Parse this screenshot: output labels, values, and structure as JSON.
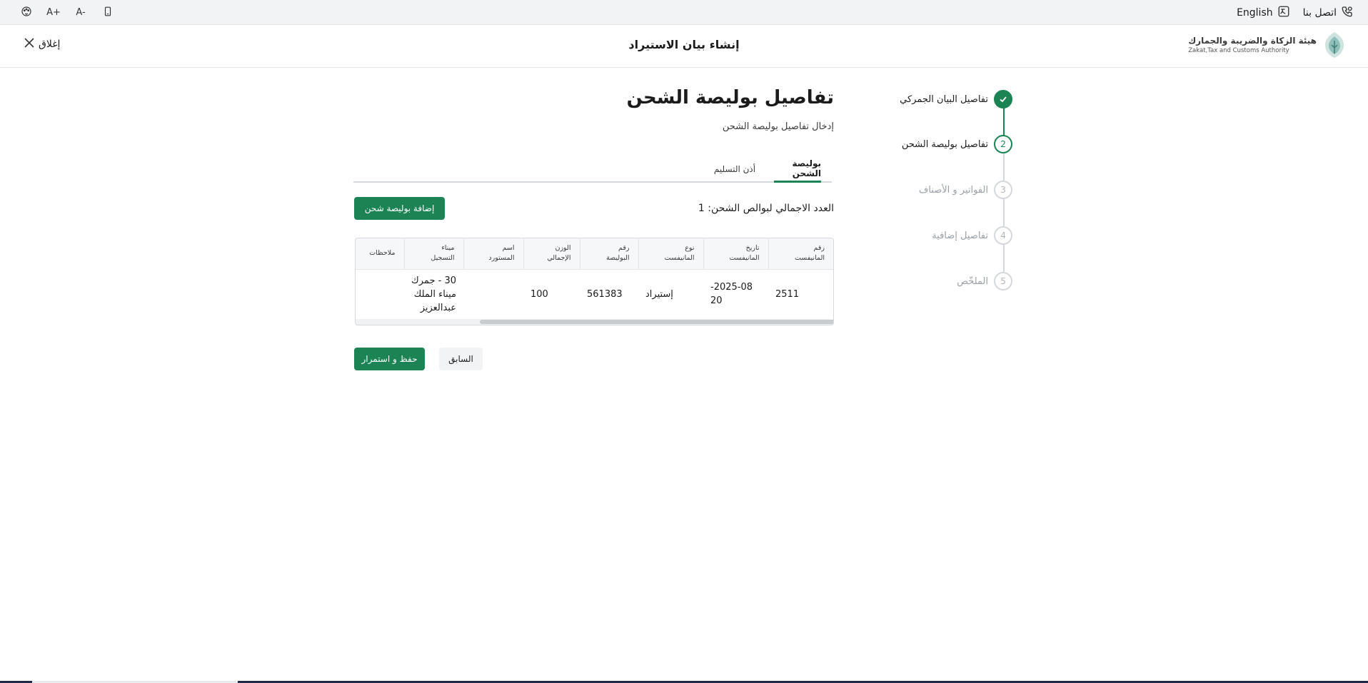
{
  "utility": {
    "contact_label": "اتصل بنا",
    "language_label": "English"
  },
  "header": {
    "logo_ar": "هيئة الزكاة والضريبة والجمارك",
    "logo_en": "Zakat,Tax and Customs Authority",
    "title": "إنشاء بيان الاستيراد",
    "close_label": "إغلاق"
  },
  "stepper": {
    "steps": [
      {
        "number": "",
        "label": "تفاصيل البيان الجمركي",
        "state": "done"
      },
      {
        "number": "2",
        "label": "تفاصيل بوليصة الشحن",
        "state": "active"
      },
      {
        "number": "3",
        "label": "الفواتير و الأصناف",
        "state": "pending"
      },
      {
        "number": "4",
        "label": "تفاصيل إضافية",
        "state": "pending"
      },
      {
        "number": "5",
        "label": "الملخّص",
        "state": "pending"
      }
    ]
  },
  "main": {
    "title": "تفاصيل بوليصة الشحن",
    "subtitle": "إدخال تفاصيل بوليصة الشحن",
    "tabs": [
      {
        "label": "بوليصة الشحن",
        "active": true
      },
      {
        "label": "أذن التسليم",
        "active": false
      }
    ],
    "count_text": "العدد الاجمالي لبوالص الشحن: 1",
    "add_button": "إضافة بوليصة شحن"
  },
  "table": {
    "headers": [
      [
        "رقم",
        "المانيفست"
      ],
      [
        "تاريخ",
        "المانيفست"
      ],
      [
        "نوع",
        "المانيفست"
      ],
      [
        "رقم",
        "البوليصة"
      ],
      [
        "الوزن",
        "الإجمالي"
      ],
      [
        "اسم",
        "المستورد"
      ],
      [
        "ميناء",
        "التسجيل"
      ],
      [
        "ملاحظات",
        ""
      ]
    ],
    "rows": [
      {
        "manifest_no": "2511",
        "manifest_date_1": "2025-08-",
        "manifest_date_2": "20",
        "manifest_type": "إستيراد",
        "bill_no": "561383",
        "total_weight": "100",
        "importer_name": "",
        "port_1": "30 - جمرك",
        "port_2": "ميناء الملك",
        "port_3": "عبدالعزيز",
        "notes": ""
      }
    ]
  },
  "actions": {
    "previous": "السابق",
    "save": "حفظ و استمرار"
  }
}
